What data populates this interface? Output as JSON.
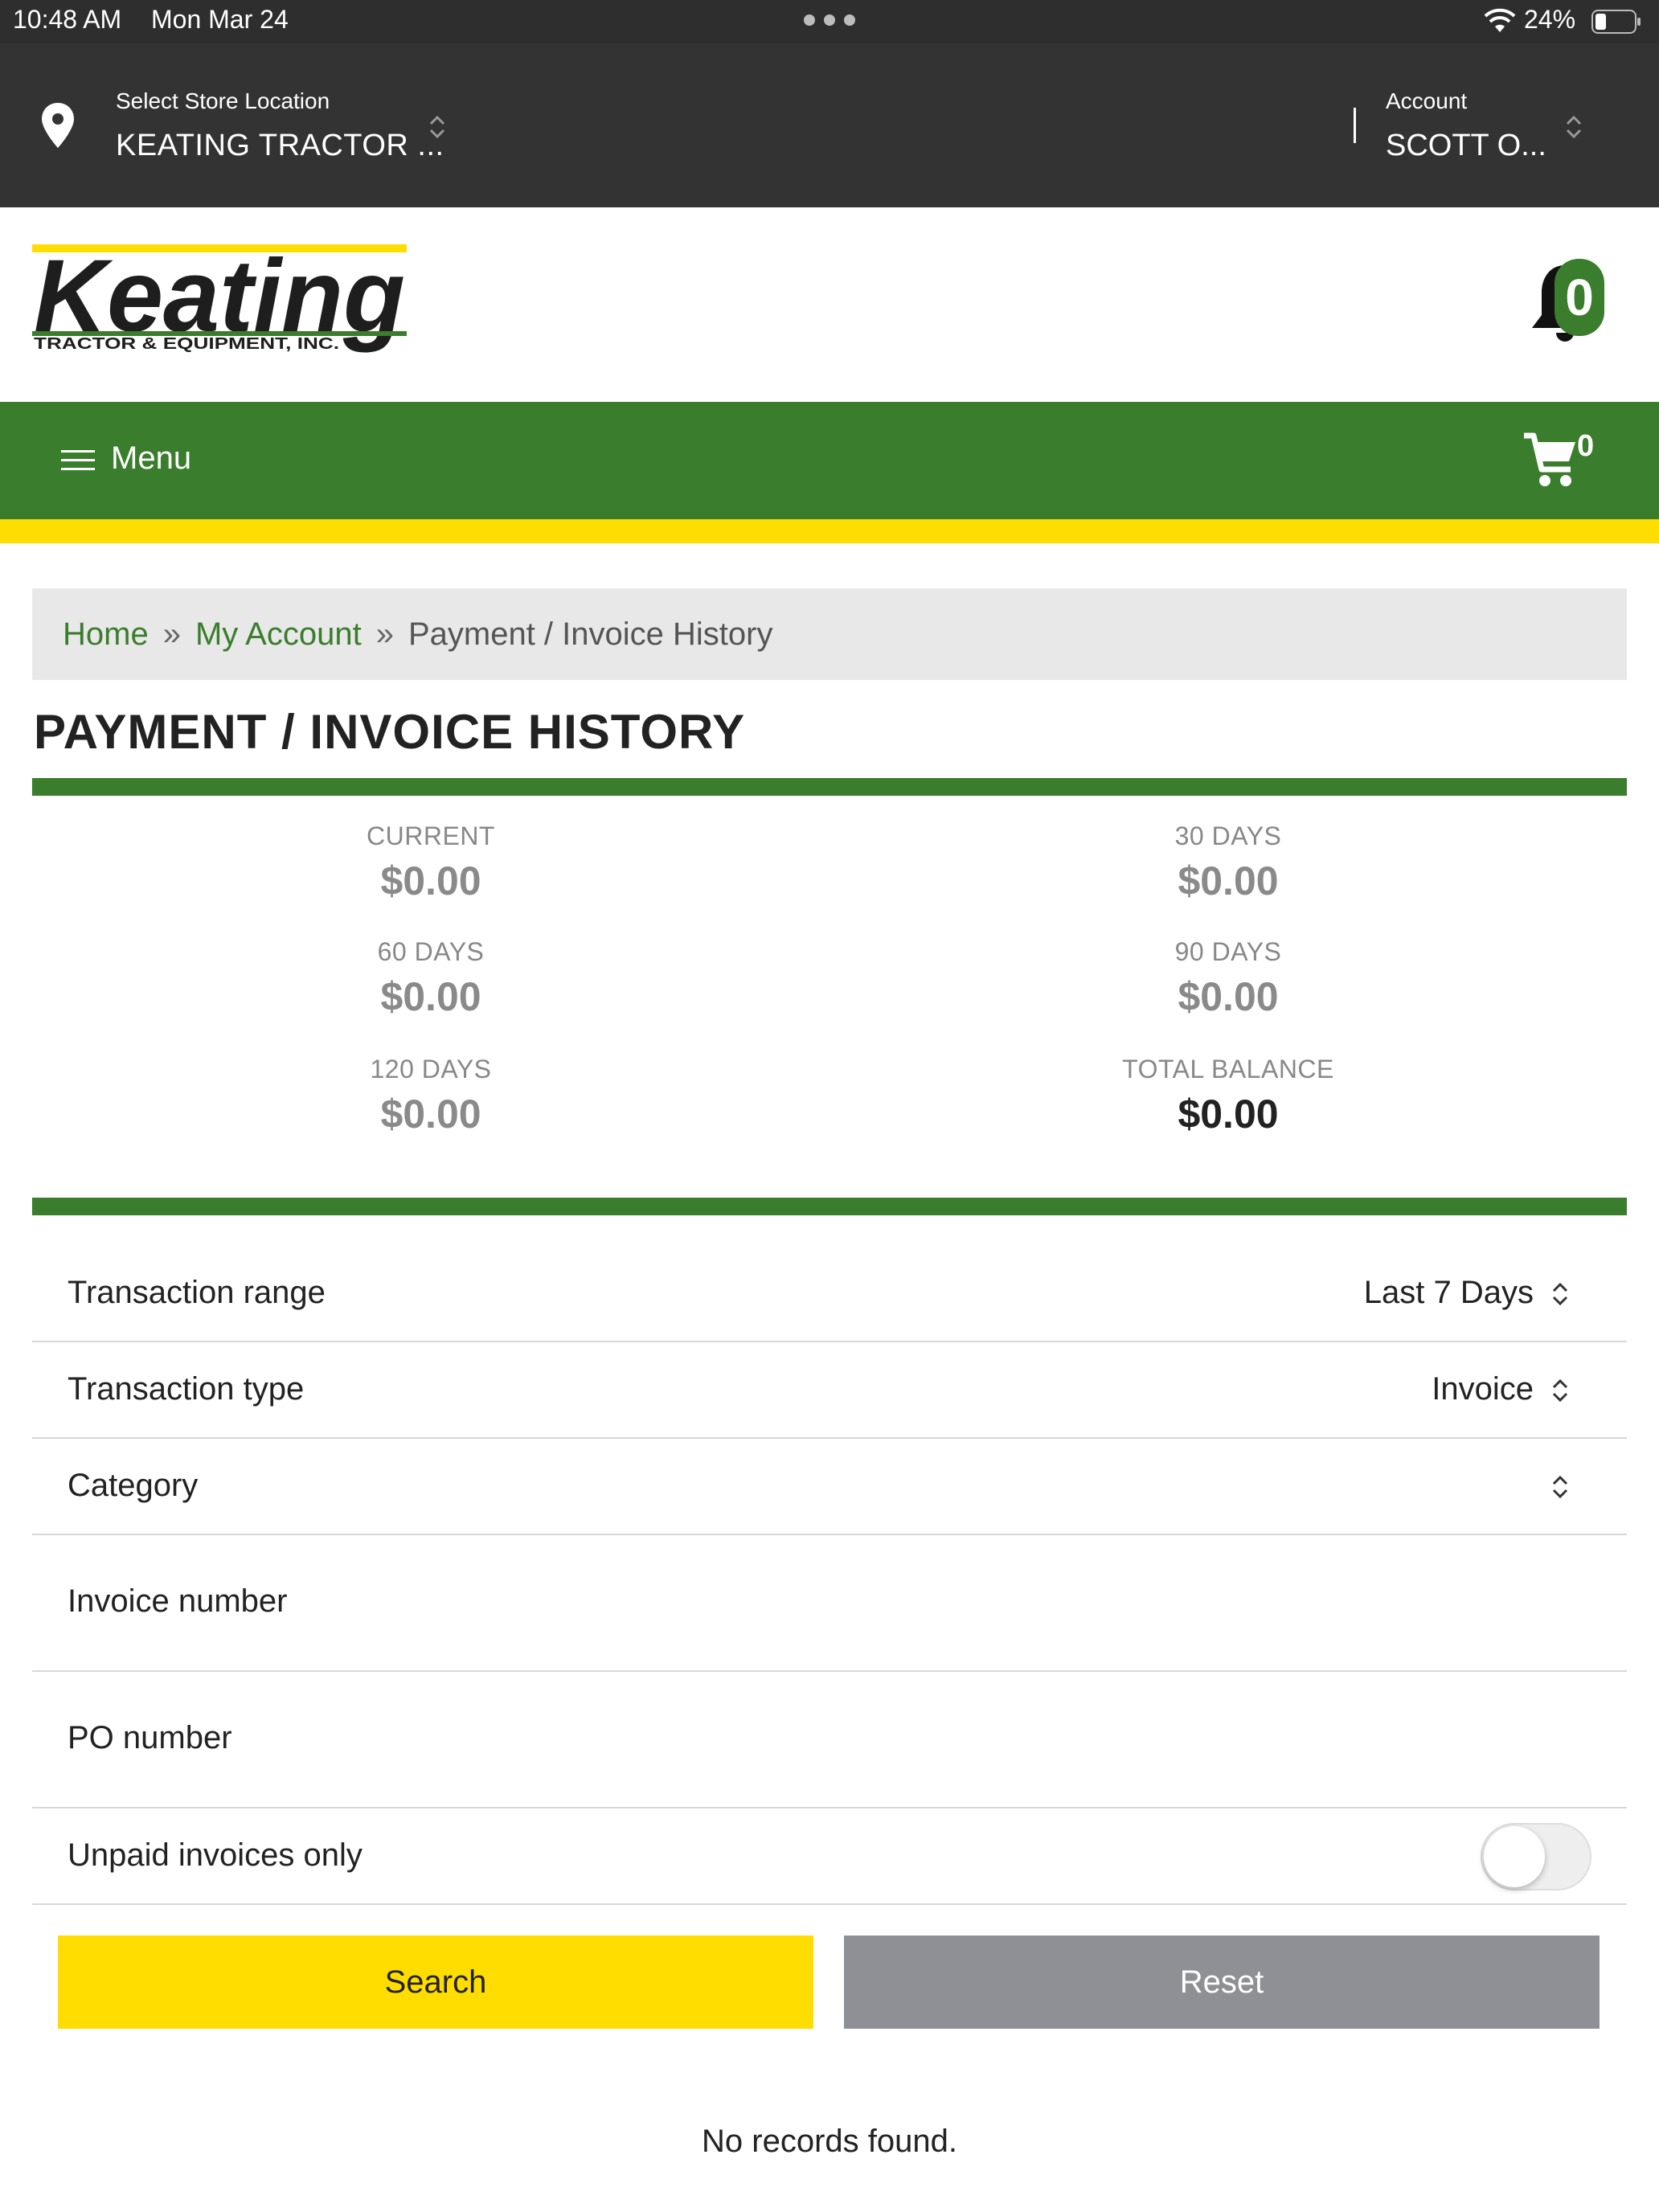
{
  "status_bar": {
    "time": "10:48 AM",
    "date": "Mon Mar 24",
    "battery": "24%"
  },
  "store_bar": {
    "store_label": "Select Store Location",
    "store_value": "KEATING TRACTOR ...",
    "account_label": "Account",
    "account_value": "SCOTT O..."
  },
  "logo": {
    "name": "Keating",
    "tagline": "TRACTOR & EQUIPMENT, INC."
  },
  "notifications": {
    "count": "0"
  },
  "menu_bar": {
    "menu_label": "Menu",
    "cart_count": "0"
  },
  "breadcrumb": {
    "home": "Home",
    "my_account": "My Account",
    "current": "Payment / Invoice History",
    "separator": "»"
  },
  "page_title": "PAYMENT / INVOICE HISTORY",
  "aging": {
    "current": {
      "label": "CURRENT",
      "value": "$0.00"
    },
    "days30": {
      "label": "30 DAYS",
      "value": "$0.00"
    },
    "days60": {
      "label": "60 DAYS",
      "value": "$0.00"
    },
    "days90": {
      "label": "90 DAYS",
      "value": "$0.00"
    },
    "days120": {
      "label": "120 DAYS",
      "value": "$0.00"
    },
    "total": {
      "label": "TOTAL BALANCE",
      "value": "$0.00"
    }
  },
  "filters": {
    "range": {
      "label": "Transaction range",
      "value": "Last 7 Days"
    },
    "type": {
      "label": "Transaction type",
      "value": "Invoice"
    },
    "category": {
      "label": "Category",
      "value": ""
    },
    "invoice_number": {
      "label": "Invoice number",
      "value": ""
    },
    "po_number": {
      "label": "PO number",
      "value": ""
    },
    "unpaid_only": {
      "label": "Unpaid invoices only",
      "enabled": false
    }
  },
  "buttons": {
    "search": "Search",
    "reset": "Reset"
  },
  "results": {
    "empty_message": "No records found."
  },
  "colors": {
    "brand_green": "#3a7d2c",
    "brand_yellow": "#ffdd00",
    "header_dark": "#333333",
    "reset_gray": "#8e9096"
  }
}
